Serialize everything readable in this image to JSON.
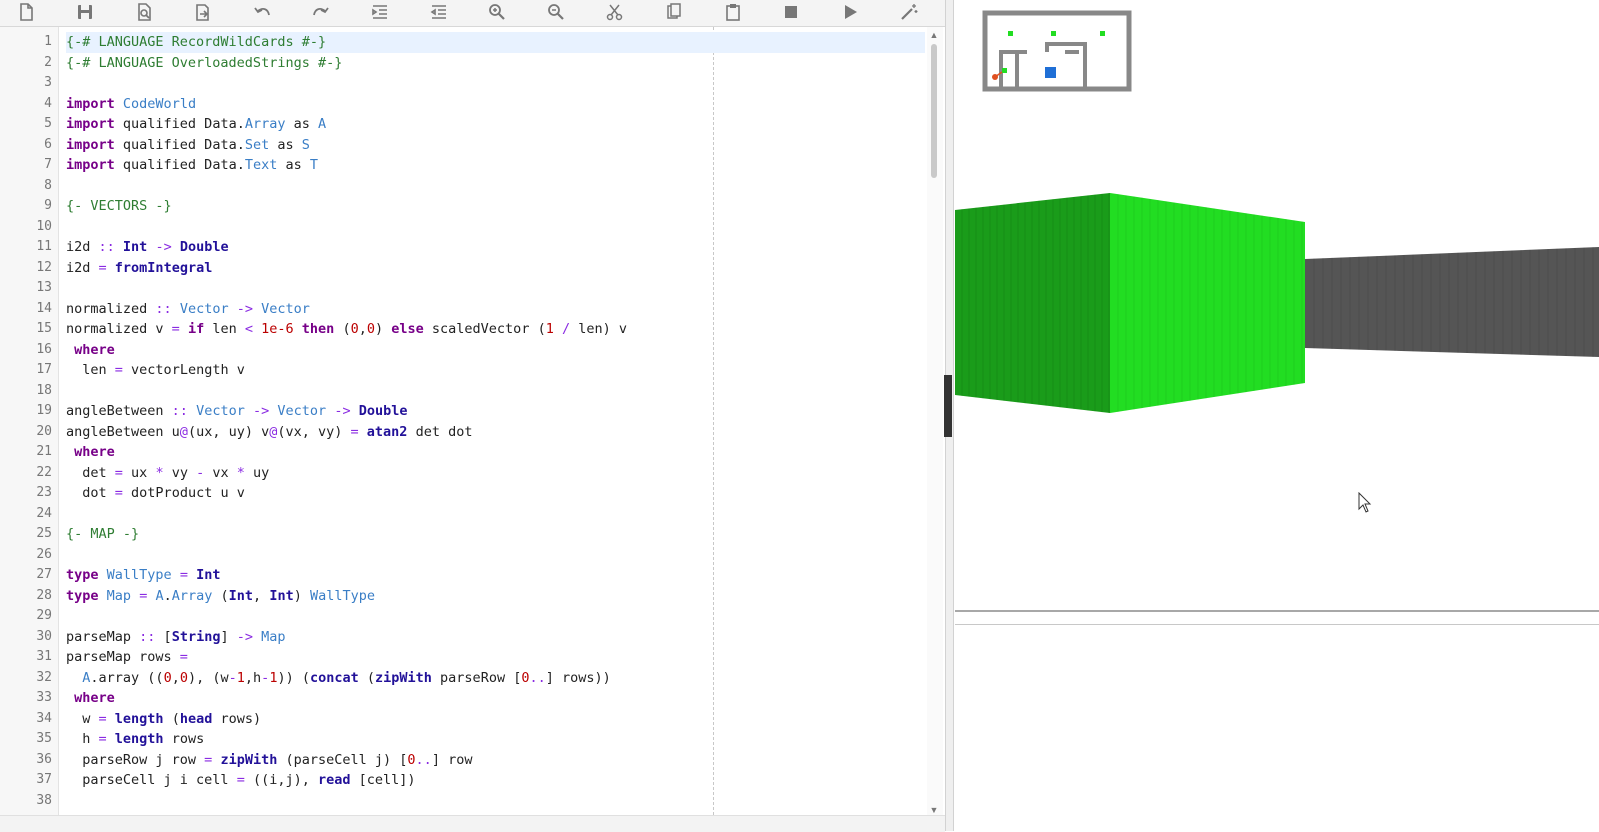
{
  "toolbar": {
    "buttons": [
      {
        "name": "new-file-button",
        "icon": "file-icon"
      },
      {
        "name": "save-button",
        "icon": "save-icon"
      },
      {
        "name": "search-file-button",
        "icon": "search-file-icon"
      },
      {
        "name": "share-button",
        "icon": "share-icon"
      },
      {
        "name": "undo-button",
        "icon": "undo-icon"
      },
      {
        "name": "redo-button",
        "icon": "redo-icon"
      },
      {
        "name": "indent-button",
        "icon": "indent-icon"
      },
      {
        "name": "outdent-button",
        "icon": "outdent-icon"
      },
      {
        "name": "zoom-in-button",
        "icon": "zoom-in-icon"
      },
      {
        "name": "zoom-out-button",
        "icon": "zoom-out-icon"
      },
      {
        "name": "cut-button",
        "icon": "scissors-icon"
      },
      {
        "name": "copy-button",
        "icon": "copy-icon"
      },
      {
        "name": "paste-button",
        "icon": "clipboard-icon"
      },
      {
        "name": "stop-button",
        "icon": "stop-icon"
      },
      {
        "name": "run-button",
        "icon": "play-icon"
      },
      {
        "name": "format-button",
        "icon": "magic-wand-icon"
      }
    ]
  },
  "editor": {
    "lines": [
      "{-# LANGUAGE RecordWildCards #-}",
      "{-# LANGUAGE OverloadedStrings #-}",
      "",
      "import CodeWorld",
      "import qualified Data.Array as A",
      "import qualified Data.Set as S",
      "import qualified Data.Text as T",
      "",
      "{- VECTORS -}",
      "",
      "i2d :: Int -> Double",
      "i2d = fromIntegral",
      "",
      "normalized :: Vector -> Vector",
      "normalized v = if len < 1e-6 then (0,0) else scaledVector (1 / len) v",
      " where",
      "  len = vectorLength v",
      "",
      "angleBetween :: Vector -> Vector -> Double",
      "angleBetween u@(ux, uy) v@(vx, vy) = atan2 det dot",
      " where",
      "  det = ux * vy - vx * uy",
      "  dot = dotProduct u v",
      "",
      "{- MAP -}",
      "",
      "type WallType = Int",
      "type Map = A.Array (Int, Int) WallType",
      "",
      "parseMap :: [String] -> Map",
      "parseMap rows =",
      "  A.array ((0,0), (w-1,h-1)) (concat (zipWith parseRow [0..] rows))",
      " where",
      "  w = length (head rows)",
      "  h = length rows",
      "  parseRow j row = zipWith (parseCell j) [0..] row",
      "  parseCell j i cell = ((i,j), read [cell])",
      ""
    ],
    "first_line_number": 1
  },
  "colors": {
    "wall_dark_green": "#1a9c1a",
    "wall_bright_green": "#22dd22",
    "wall_gray": "#555555",
    "minimap_border": "#888888",
    "player_blue": "#1f6fd6",
    "player_marker": "#e05020"
  }
}
